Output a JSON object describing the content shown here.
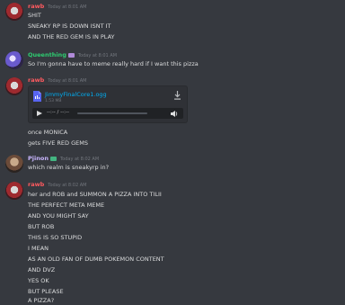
{
  "colors": {
    "rawb": "#ff5a5f",
    "queenthing": "#2ecc71",
    "pjinon": "#c9b6ff",
    "link": "#00aff4"
  },
  "messages": [
    {
      "author": "rawb",
      "timestamp": "Today at 8:01 AM",
      "lines": [
        "SHIT",
        "SNEAKY RP IS DOWN ISNT IT",
        "AND THE RED GEM IS IN PLAY"
      ]
    },
    {
      "author": "Queenthing",
      "timestamp": "Today at 8:01 AM",
      "lines": [
        "So I'm gonna have to meme really hard if I want this pizza"
      ]
    },
    {
      "author": "rawb",
      "timestamp": "Today at 8:01 AM",
      "attachment": {
        "filename": "JimmyFinalCore1.ogg",
        "size": "1.53 MB",
        "time": "--:-- / --:--"
      },
      "lines": [
        "once MONICA",
        "gets FIVE RED GEMS"
      ]
    },
    {
      "author": "Pjinon",
      "timestamp": "Today at 8:02 AM",
      "lines": [
        "which realm is sneakyrp in?"
      ]
    },
    {
      "author": "rawb",
      "timestamp": "Today at 8:02 AM",
      "lines": [
        "her and ROB and SUMMON A PIZZA INTO TILII",
        "THE PERFECT META MEME",
        "AND YOU MIGHT SAY",
        "BUT ROB",
        "THIS IS SO STUPID",
        "I MEAN",
        "AS AN OLD FAN OF DUMB POKEMON CONTENT",
        "AND DVZ",
        "YES OK",
        "BUT PLEASE",
        "A PIZZA?"
      ]
    }
  ]
}
